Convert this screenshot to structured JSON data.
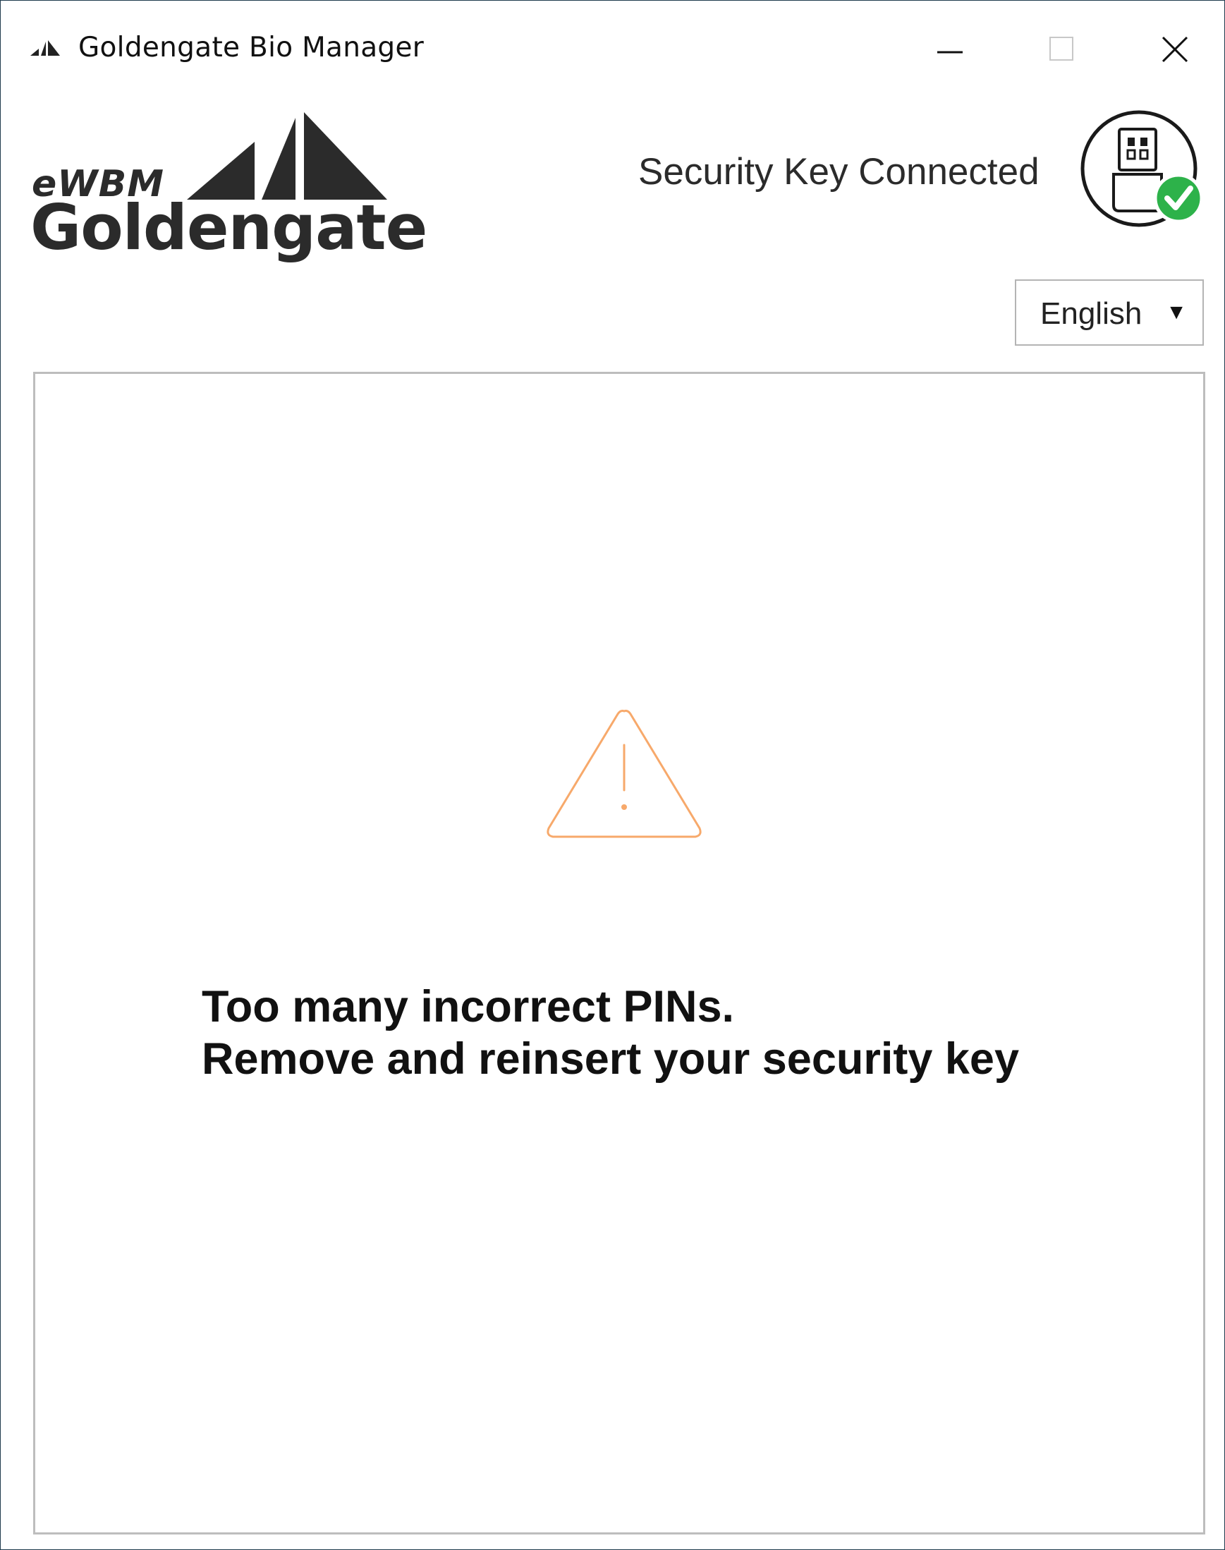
{
  "window": {
    "title": "Goldengate Bio Manager",
    "app_icon": "app-logo-icon",
    "controls": [
      "minimize-icon",
      "maximize-icon",
      "close-icon"
    ]
  },
  "logo": {
    "brand_top": "eWBM",
    "brand_name": "Goldengate"
  },
  "status": {
    "text": "Security Key Connected",
    "icon": "usb-key-connected-icon",
    "check_color": "#2db24a"
  },
  "language": {
    "selected": "English",
    "arrow": "▼"
  },
  "message": {
    "icon": "warning-icon",
    "icon_color": "#f7a96b",
    "line1": "Too many incorrect PINs.",
    "line2": "Remove and reinsert your security key"
  }
}
